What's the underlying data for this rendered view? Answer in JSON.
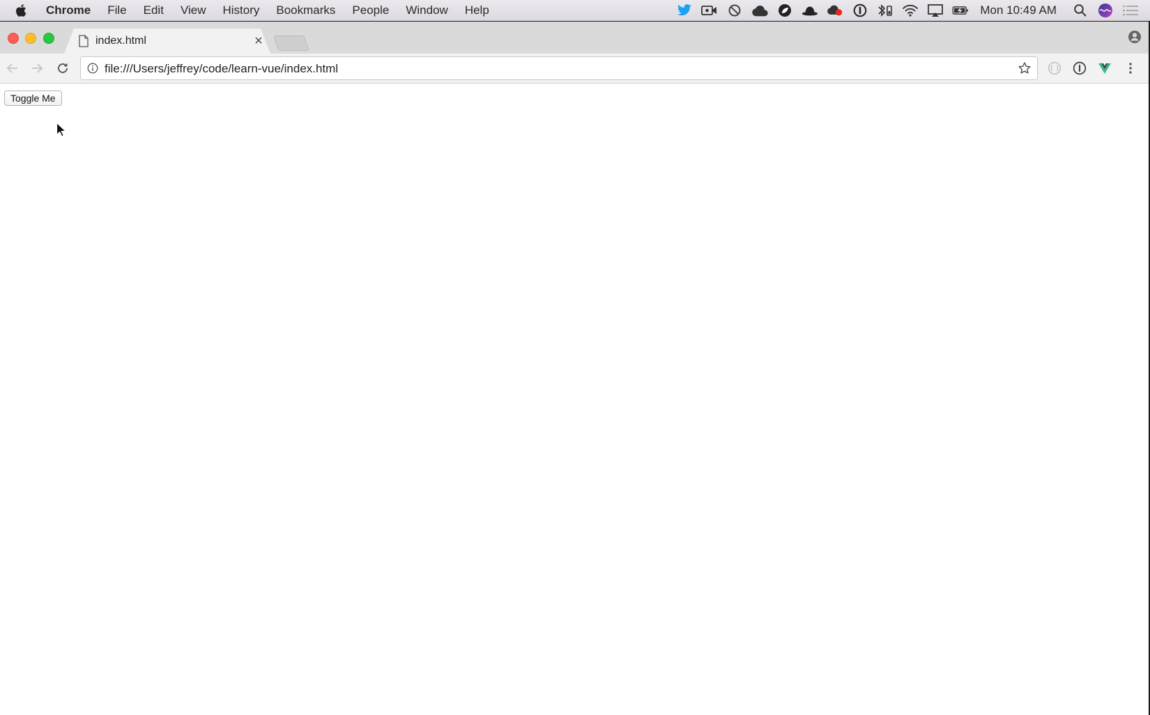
{
  "menubar": {
    "app_name": "Chrome",
    "items": [
      "File",
      "Edit",
      "View",
      "History",
      "Bookmarks",
      "People",
      "Window",
      "Help"
    ],
    "clock": "Mon 10:49 AM"
  },
  "browser": {
    "tab_title": "index.html",
    "url": "file:///Users/jeffrey/code/learn-vue/index.html"
  },
  "page": {
    "toggle_button_label": "Toggle Me"
  },
  "colors": {
    "menubar_bg": "#e6e3e9",
    "tabstrip_bg": "#dadada",
    "toolbar_bg": "#f2f2f2",
    "twitter_blue": "#1da1f2",
    "vue_green": "#41b883",
    "traffic_red": "#fc5f57",
    "traffic_yellow": "#fdbc2e",
    "traffic_green": "#28c840"
  }
}
